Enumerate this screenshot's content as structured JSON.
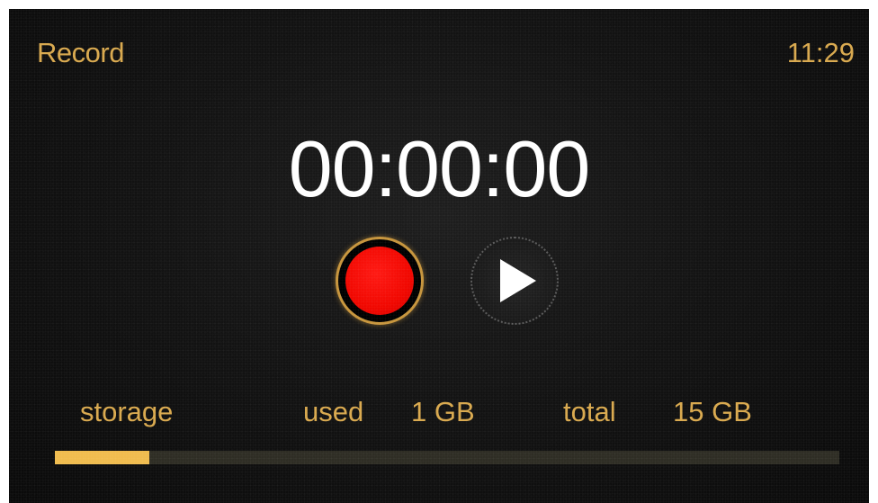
{
  "header": {
    "title": "Record",
    "time": "11:29"
  },
  "recorder": {
    "elapsed": "00:00:00",
    "record_icon": "record-icon",
    "play_icon": "play-icon"
  },
  "storage": {
    "label": "storage",
    "used_label": "used",
    "used_value": "1 GB",
    "total_label": "total",
    "total_value": "15 GB",
    "used_fraction": 0.12
  },
  "colors": {
    "accent": "#d9a94e",
    "record": "#f10700",
    "bar_fill": "#f0bc4e",
    "bar_track": "#2e2d24"
  }
}
